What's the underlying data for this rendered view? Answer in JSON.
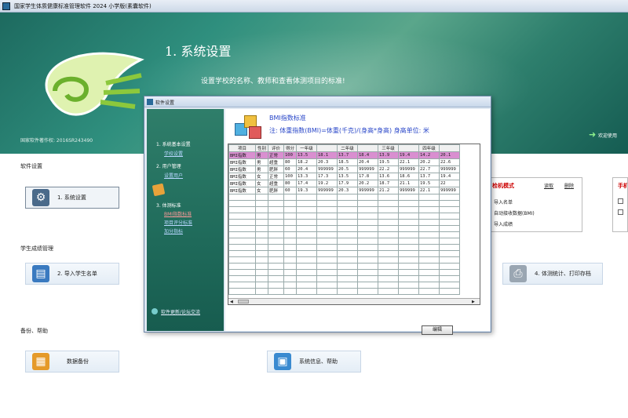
{
  "window": {
    "title": "国家学生体质健康标准管理软件 2024 小学版(素囊软件)"
  },
  "banner": {
    "heading": "1. 系统设置",
    "subtitle": "设置学校的名称、教师和查看体测项目的标准!",
    "copyright": "国家软件著作权: 2016SR243490",
    "welcome": "欢迎使用"
  },
  "sections": {
    "software_settings": "软件设置",
    "score_management": "学生成绩管理",
    "backup_help": "备份、帮助"
  },
  "tiles": {
    "system_settings": "1. 系统设置",
    "import_students": "2. 导入学生名单",
    "stats_print": "4. 体测统计、打印存档",
    "data_backup": "数据备份",
    "system_info": "系统信息、帮助"
  },
  "right_panel": {
    "title": "检机模式",
    "read": "读取",
    "delete": "删除",
    "import_names": "导入名单",
    "auto_receive": "自动接收数据(BMI)",
    "import_scores": "导入成绩",
    "title2": "手机"
  },
  "dialog": {
    "title": "软件设置",
    "nav": {
      "sec1": "1. 系统基本设置",
      "school_settings": "学校设置",
      "sec2": "2. 用户管理",
      "user_settings": "设置用户",
      "sec3": "3. 体测标准",
      "bmi_standard": "BMI指数标准",
      "item_scoring": "项目评分标准",
      "bonus_items": "加分指标",
      "update": "软件更新/论坛交流"
    },
    "header_title": "BMI指数标准",
    "header_note": "注: 体重指数(BMI)=体重(千克)/(身高*身高) 身高单位: 米",
    "edit_button": "编辑",
    "table": {
      "columns": [
        "项目",
        "性别",
        "评价",
        "得分",
        "一年级",
        "",
        "二年级",
        "",
        "三年级",
        "",
        "四年级",
        ""
      ],
      "rows": [
        [
          "BMI指数",
          "男",
          "正常",
          "100",
          "13.5",
          "18.1",
          "13.7",
          "18.4",
          "13.9",
          "19.4",
          "14.2",
          "20.1"
        ],
        [
          "BMI指数",
          "男",
          "超重",
          "80",
          "18.2",
          "20.3",
          "18.5",
          "20.4",
          "19.5",
          "22.1",
          "20.2",
          "22.6"
        ],
        [
          "BMI指数",
          "男",
          "肥胖",
          "60",
          "20.4",
          "999999",
          "20.5",
          "999999",
          "22.2",
          "999999",
          "22.7",
          "999999"
        ],
        [
          "BMI指数",
          "女",
          "正常",
          "100",
          "13.3",
          "17.3",
          "13.5",
          "17.8",
          "13.6",
          "18.6",
          "13.7",
          "19.4"
        ],
        [
          "BMI指数",
          "女",
          "超重",
          "80",
          "17.4",
          "19.2",
          "17.9",
          "20.2",
          "18.7",
          "21.1",
          "19.5",
          "22"
        ],
        [
          "BMI指数",
          "女",
          "肥胖",
          "60",
          "19.3",
          "999999",
          "20.3",
          "999999",
          "21.2",
          "999999",
          "22.1",
          "999999"
        ]
      ]
    }
  }
}
